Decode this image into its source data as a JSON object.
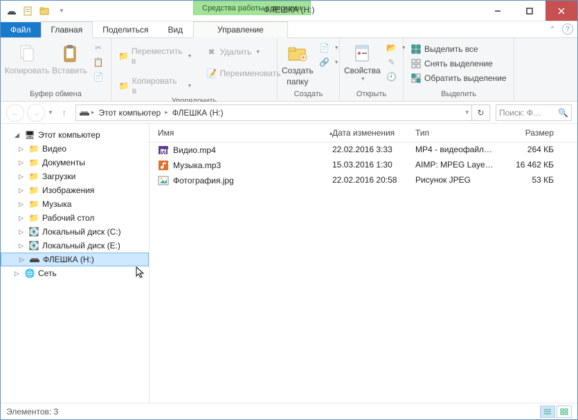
{
  "titlebar": {
    "disk_tools": "Средства работы с дисками",
    "title": "ФЛЕШКА (H:)"
  },
  "tabs": {
    "file": "Файл",
    "home": "Главная",
    "share": "Поделиться",
    "view": "Вид",
    "manage": "Управление"
  },
  "ribbon": {
    "clipboard": {
      "copy": "Копировать",
      "paste": "Вставить",
      "label": "Буфер обмена"
    },
    "organize": {
      "move_to": "Переместить в",
      "copy_to": "Копировать в",
      "delete": "Удалить",
      "rename": "Переименовать",
      "label": "Упорядочить"
    },
    "new": {
      "new_folder_l1": "Создать",
      "new_folder_l2": "папку",
      "label": "Создать"
    },
    "open": {
      "properties": "Свойства",
      "label": "Открыть"
    },
    "select": {
      "select_all": "Выделить все",
      "select_none": "Снять выделение",
      "invert": "Обратить выделение",
      "label": "Выделить"
    }
  },
  "breadcrumb": {
    "this_pc": "Этот компьютер",
    "drive": "ФЛЕШКА (H:)"
  },
  "search_placeholder": "Поиск: Ф…",
  "tree": {
    "this_pc": "Этот компьютер",
    "videos": "Видео",
    "documents": "Документы",
    "downloads": "Загрузки",
    "pictures": "Изображения",
    "music": "Музыка",
    "desktop": "Рабочий стол",
    "disk_c": "Локальный диск (C:)",
    "disk_e": "Локальный диск (E:)",
    "flash": "ФЛЕШКА (H:)",
    "network": "Сеть"
  },
  "columns": {
    "name": "Имя",
    "date": "Дата изменения",
    "type": "Тип",
    "size": "Размер"
  },
  "files": [
    {
      "name": "Видио.mp4",
      "date": "22.02.2016 3:33",
      "type": "MP4 - видеофайл…",
      "size": "264 КБ",
      "icon": "video"
    },
    {
      "name": "Музыка.mp3",
      "date": "15.03.2016 1:30",
      "type": "AIMP: MPEG Laye…",
      "size": "16 462 КБ",
      "icon": "audio"
    },
    {
      "name": "Фотография.jpg",
      "date": "22.02.2016 20:58",
      "type": "Рисунок JPEG",
      "size": "53 КБ",
      "icon": "image"
    }
  ],
  "status": "Элементов: 3"
}
